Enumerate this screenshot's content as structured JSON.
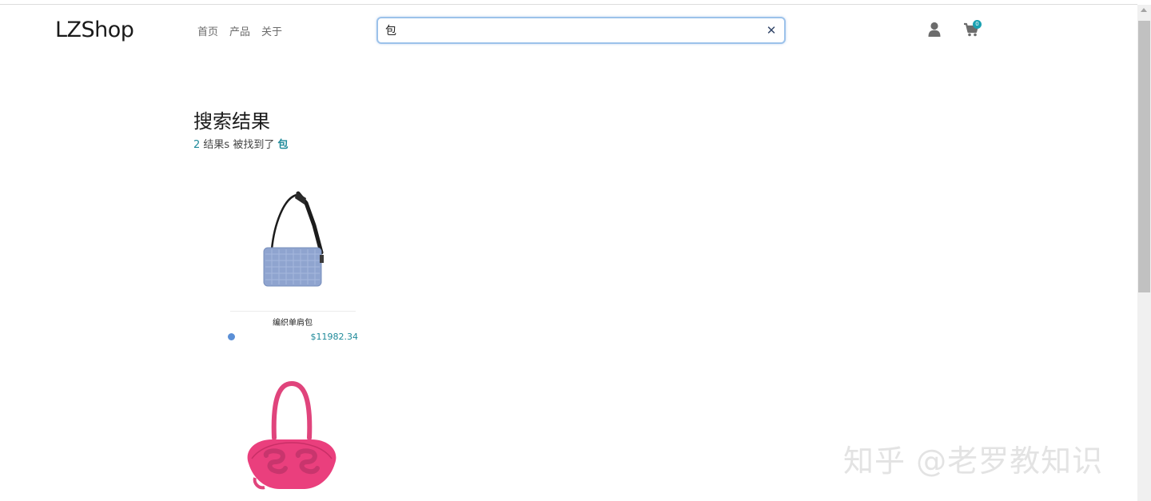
{
  "brand": {
    "logo": "LZShop"
  },
  "nav": {
    "items": [
      "首页",
      "产品",
      "关于"
    ]
  },
  "search": {
    "value": "包",
    "clear_icon": "close-icon"
  },
  "header_icons": {
    "user": "user-icon",
    "cart": "cart-icon",
    "cart_count": "0"
  },
  "results": {
    "title": "搜索结果",
    "count": "2",
    "summary_text": "结果s 被找到了",
    "term": "包"
  },
  "products": [
    {
      "name": "编织单肩包",
      "price": "$11982.34",
      "color": "#5b8fd6"
    },
    {
      "name": "",
      "price": "",
      "color": "#e8437d"
    }
  ],
  "watermark": "知乎 @老罗教知识",
  "colors": {
    "accent": "#1f8a9a",
    "badge": "#1ba1b2",
    "search_border": "#9cc2ea"
  }
}
